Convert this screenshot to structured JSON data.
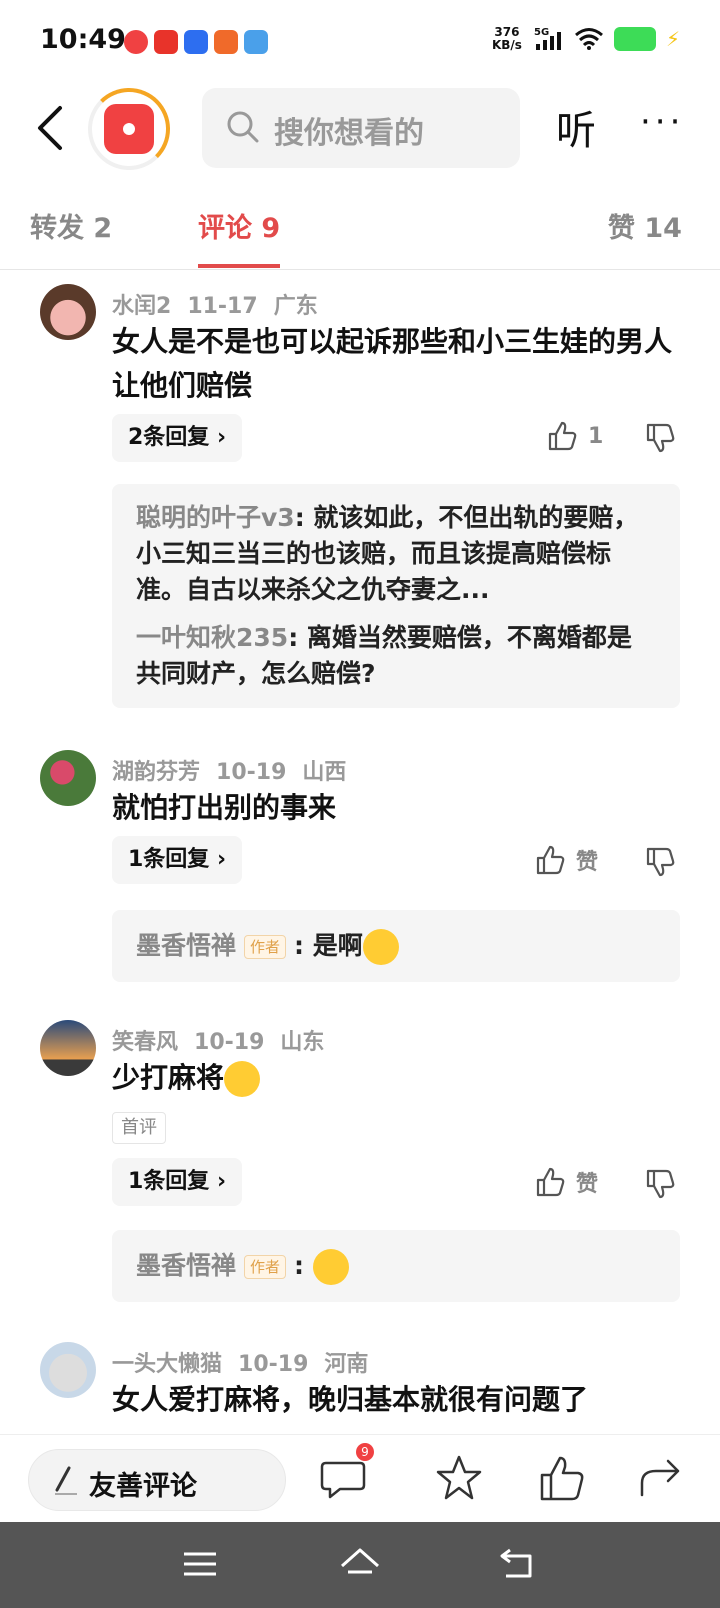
{
  "status_bar": {
    "time": "10:49",
    "speed_value": "376",
    "speed_unit": "KB/s",
    "network": "5G"
  },
  "header": {
    "search_placeholder": "搜你想看的",
    "listen_label": "听",
    "more_label": "···"
  },
  "tabs": [
    {
      "label": "转发 2"
    },
    {
      "label": "评论 9"
    },
    {
      "label": "赞 14"
    }
  ],
  "comments": [
    {
      "user": "水闰2",
      "date": "11-17",
      "location": "广东",
      "text": "女人是不是也可以起诉那些和小三生娃的男人让他们赔偿",
      "reply_count": "2条回复",
      "likes": "1",
      "replies": [
        {
          "name": "聪明的叶子v3",
          "text": "就该如此，不但出轨的要赔，小三知三当三的也该赔，而且该提高赔偿标准。自古以来杀父之仇夺妻之..."
        },
        {
          "name": "一叶知秋235",
          "text": "离婚当然要赔偿，不离婚都是共同财产，怎么赔偿?"
        }
      ]
    },
    {
      "user": "湖韵芬芳",
      "date": "10-19",
      "location": "山西",
      "text": "就怕打出别的事来",
      "reply_count": "1条回复",
      "likes": "赞",
      "replies": [
        {
          "name": "墨香悟禅",
          "tag": "作者",
          "text": "是啊"
        }
      ]
    },
    {
      "user": "笑春风",
      "date": "10-19",
      "location": "山东",
      "text": "少打麻将",
      "badge": "首评",
      "reply_count": "1条回复",
      "likes": "赞",
      "replies": [
        {
          "name": "墨香悟禅",
          "tag": "作者",
          "text": ""
        }
      ]
    },
    {
      "user": "一头大懒猫",
      "date": "10-19",
      "location": "河南",
      "text": "女人爱打麻将，晚归基本就很有问题了"
    }
  ],
  "bottom_bar": {
    "comment_placeholder": "友善评论",
    "comment_count_badge": "9"
  }
}
